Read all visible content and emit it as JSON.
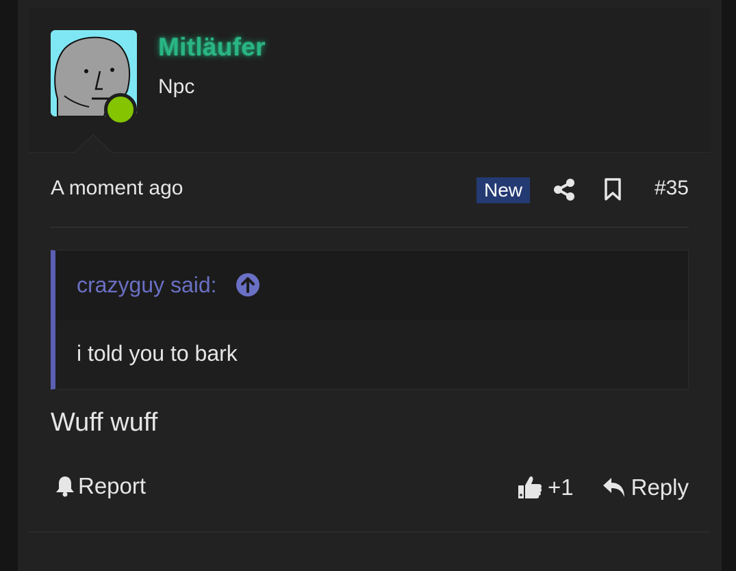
{
  "user": {
    "name": "Mitläufer",
    "title": "Npc",
    "online": true,
    "avatar_icon": "npc-wojak-avatar",
    "name_color": "#2ab585"
  },
  "post_meta": {
    "timestamp": "A moment ago",
    "badge": "New",
    "badge_color": "#243a73",
    "share_icon": "share-icon",
    "bookmark_icon": "bookmark-icon",
    "post_number": "#35"
  },
  "quote": {
    "author": "crazyguy said:",
    "jump_icon": "arrow-circle-up-icon",
    "body": "i told you to bark",
    "accent_color": "#5c5fb3"
  },
  "message": "Wuff wuff",
  "actions": {
    "report_label": "Report",
    "like_count": "+1",
    "reply_label": "Reply"
  }
}
